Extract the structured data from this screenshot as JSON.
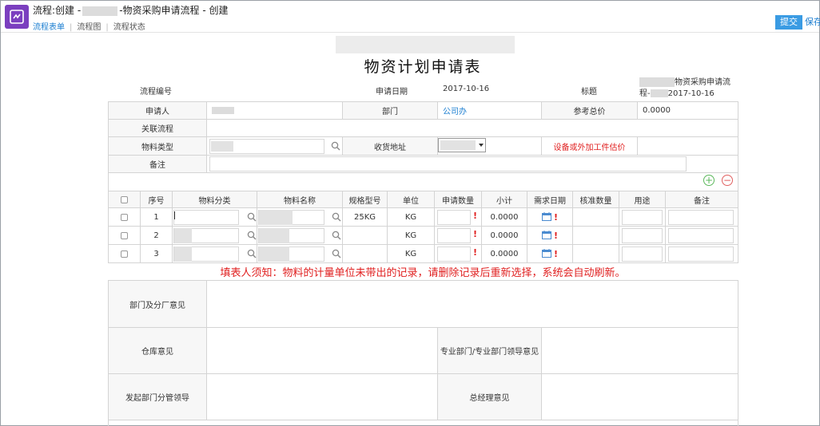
{
  "header": {
    "title_prefix": "流程:创建 -",
    "title_suffix": "-物资采购申请流程 - 创建",
    "tabs": [
      "流程表单",
      "流程图",
      "流程状态"
    ],
    "submit_label": "提交",
    "save_label": "保存"
  },
  "form": {
    "title": "物资计划申请表",
    "flow_no_label": "流程编号",
    "apply_date_label": "申请日期",
    "apply_date_value": "2017-10-16",
    "subject_label": "标题",
    "subject_line1": "物资采购申请流",
    "subject_line2_prefix": "程-",
    "subject_line2_date": "2017-10-16",
    "applicant_label": "申请人",
    "department_label": "部门",
    "department_value": "公司办",
    "ref_total_label": "参考总价",
    "ref_total_value": "0.0000",
    "related_flow_label": "关联流程",
    "material_type_label": "物料类型",
    "delivery_address_label": "收货地址",
    "estimate_link": "设备或外加工件估价",
    "remark_label": "备注"
  },
  "details": {
    "columns": [
      "序号",
      "物料分类",
      "物料名称",
      "规格型号",
      "单位",
      "申请数量",
      "小计",
      "需求日期",
      "核准数量",
      "用途",
      "备注"
    ],
    "rows": [
      {
        "no": "1",
        "spec": "25KG",
        "unit": "KG",
        "subtotal": "0.0000"
      },
      {
        "no": "2",
        "spec": "",
        "unit": "KG",
        "subtotal": "0.0000"
      },
      {
        "no": "3",
        "spec": "",
        "unit": "KG",
        "subtotal": "0.0000"
      }
    ],
    "required_mark": "!"
  },
  "notice": "填表人须知：物料的计量单位未带出的记录，请删除记录后重新选择，系统会自动刷新。",
  "approvals": {
    "dept_opinion": "部门及分厂意见",
    "warehouse_opinion": "仓库意见",
    "specialist_opinion": "专业部门/专业部门领导意见",
    "initiator_leader": "发起部门分管领导",
    "gm_opinion": "总经理意见"
  },
  "colors": {
    "accent": "#1a7dd0",
    "submit": "#3a9be3",
    "required": "#e02020",
    "logo": "#7b3fbf",
    "add": "#5cb85c",
    "remove": "#e06060"
  }
}
